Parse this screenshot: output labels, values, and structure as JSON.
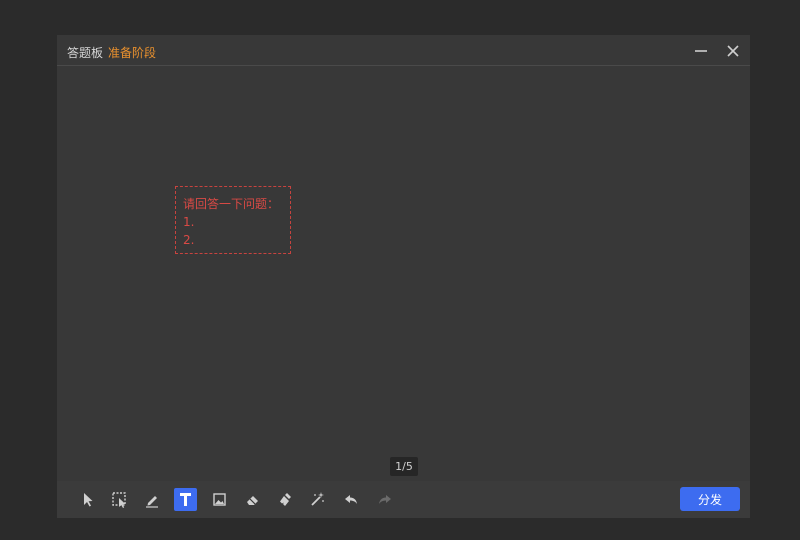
{
  "header": {
    "title": "答题板",
    "stage": "准备阶段"
  },
  "window_controls": [
    "minimize-icon",
    "close-icon"
  ],
  "canvas": {
    "question_lines": [
      "请回答一下问题：",
      "1.",
      "2."
    ]
  },
  "pagination": {
    "label": "1/5"
  },
  "toolbar": {
    "tools": [
      {
        "name": "select-pointer-icon",
        "active": false
      },
      {
        "name": "box-select-icon",
        "active": false
      },
      {
        "name": "pen-icon",
        "active": false
      },
      {
        "name": "text-icon",
        "active": true
      },
      {
        "name": "image-icon",
        "active": false
      },
      {
        "name": "eraser-icon",
        "active": false
      },
      {
        "name": "clear-brush-icon",
        "active": false
      },
      {
        "name": "magic-wand-icon",
        "active": false
      },
      {
        "name": "undo-icon",
        "active": false
      },
      {
        "name": "redo-icon",
        "active": false,
        "disabled": true
      }
    ],
    "send_label": "分发"
  },
  "colors": {
    "background": "#2b2b2b",
    "board": "#383838",
    "accent": "#3d6cf0",
    "stage_text": "#e8902e",
    "question_text": "#d94a45"
  }
}
